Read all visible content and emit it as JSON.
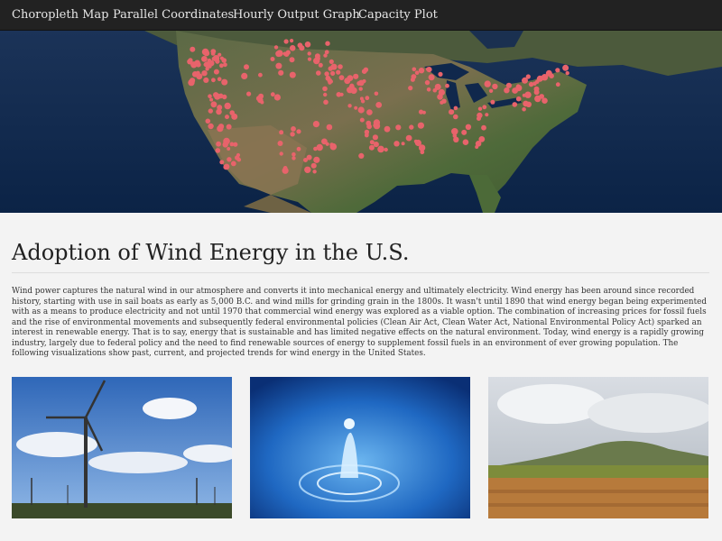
{
  "nav": {
    "items": [
      {
        "label": "Choropleth Map"
      },
      {
        "label": "Parallel Coordinates"
      },
      {
        "label": "Hourly Output Graph"
      },
      {
        "label": "Capacity Plot"
      }
    ]
  },
  "hero": {
    "description": "",
    "dot_color": "#e8636b"
  },
  "main": {
    "title": "Adoption of Wind Energy in the U.S.",
    "paragraph": "Wind power captures the natural wind in our atmosphere and converts it into mechanical energy and ultimately electricity. Wind energy has been around since recorded history, starting with use in sail boats as early as 5,000 B.C. and wind mills for grinding grain in the 1800s. It wasn't until 1890 that wind energy began being experimented with as a means to produce electricity and not until 1970 that commercial wind energy was explored as a viable option. The combination of increasing prices for fossil fuels and the rise of environmental movements and subsequently federal environmental policies (Clean Air Act, Clean Water Act, National Environmental Policy Act) sparked an interest in renewable energy. That is to say, energy that is sustainable and has limited negative effects on the natural environment. Today, wind energy is a rapidly growing industry, largely due to federal policy and the need to find renewable sources of energy to supplement fossil fuels in an environment of ever growing population. The following visualizations show past, current, and projected trends for wind energy in the United States."
  },
  "colors": {
    "navbar_bg": "#222222",
    "nav_text": "#e6e6e6",
    "page_bg": "#f3f3f3",
    "title_text": "#222222",
    "body_text": "#333333"
  }
}
